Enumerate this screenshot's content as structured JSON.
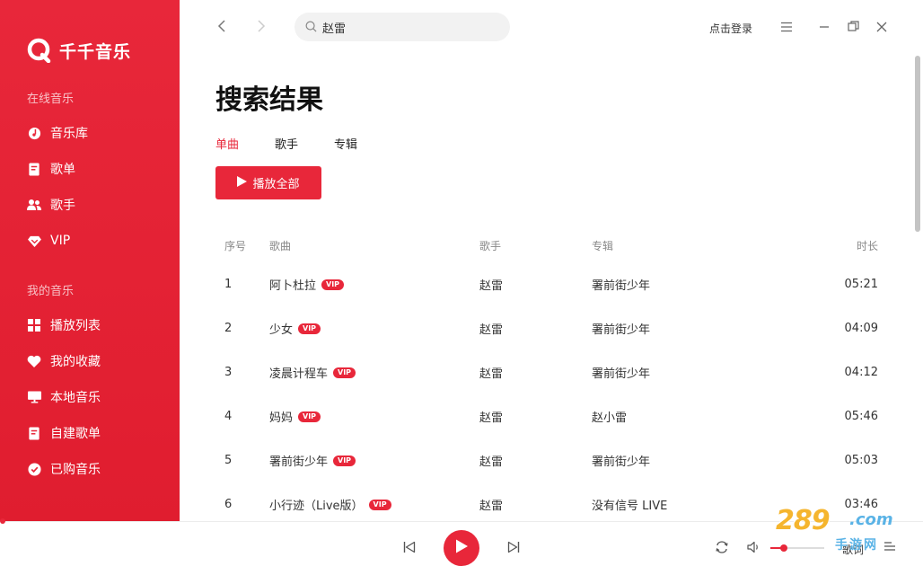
{
  "app": {
    "logo_text": "千千音乐"
  },
  "sidebar": {
    "online_title": "在线音乐",
    "online_items": [
      {
        "label": "音乐库",
        "icon": "disc-icon"
      },
      {
        "label": "歌单",
        "icon": "document-icon"
      },
      {
        "label": "歌手",
        "icon": "users-icon"
      },
      {
        "label": "VIP",
        "icon": "diamond-icon"
      }
    ],
    "my_title": "我的音乐",
    "my_items": [
      {
        "label": "播放列表",
        "icon": "grid-icon"
      },
      {
        "label": "我的收藏",
        "icon": "heart-icon"
      },
      {
        "label": "本地音乐",
        "icon": "monitor-icon"
      },
      {
        "label": "自建歌单",
        "icon": "document-icon"
      },
      {
        "label": "已购音乐",
        "icon": "check-circle-icon"
      }
    ]
  },
  "topbar": {
    "search_value": "赵雷",
    "login_label": "点击登录"
  },
  "main": {
    "title": "搜索结果",
    "tabs": [
      {
        "label": "单曲",
        "active": true
      },
      {
        "label": "歌手",
        "active": false
      },
      {
        "label": "专辑",
        "active": false
      }
    ],
    "play_all_label": "播放全部",
    "table": {
      "headers": {
        "index": "序号",
        "song": "歌曲",
        "artist": "歌手",
        "album": "专辑",
        "duration": "时长"
      },
      "vip_badge": "VIP",
      "rows": [
        {
          "index": "1",
          "song": "阿卜杜拉",
          "artist": "赵雷",
          "album": "署前街少年",
          "duration": "05:21"
        },
        {
          "index": "2",
          "song": "少女",
          "artist": "赵雷",
          "album": "署前街少年",
          "duration": "04:09"
        },
        {
          "index": "3",
          "song": "凌晨计程车",
          "artist": "赵雷",
          "album": "署前街少年",
          "duration": "04:12"
        },
        {
          "index": "4",
          "song": "妈妈",
          "artist": "赵雷",
          "album": "赵小雷",
          "duration": "05:46"
        },
        {
          "index": "5",
          "song": "署前街少年",
          "artist": "赵雷",
          "album": "署前街少年",
          "duration": "05:03"
        },
        {
          "index": "6",
          "song": "小行迹（Live版）",
          "artist": "赵雷",
          "album": "没有信号 LIVE",
          "duration": "03:46"
        }
      ]
    }
  },
  "player": {
    "lyrics_label": "歌词",
    "volume_fraction": 0.25
  },
  "watermark": {
    "number": "289",
    "domain": ".com",
    "sub": "手游网"
  },
  "colors": {
    "accent": "#e8273a"
  }
}
